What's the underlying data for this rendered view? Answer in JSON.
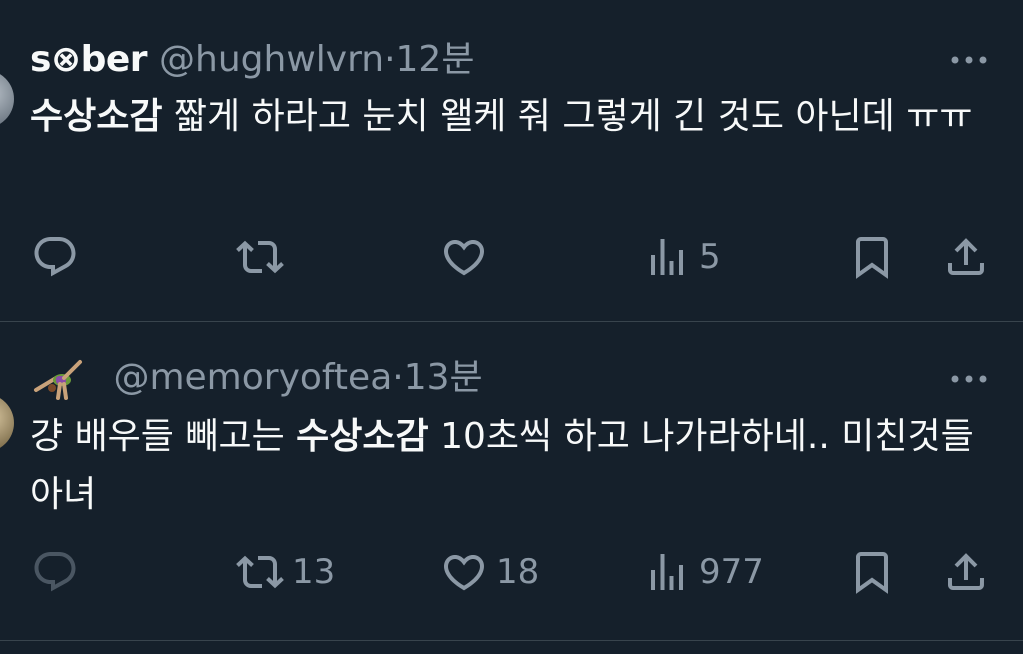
{
  "tweets": [
    {
      "name": "s⊗ber",
      "handle": "@hughwlvrn",
      "dot": "·",
      "time": "12분",
      "text_hl": "수상소감",
      "text_rest": " 짧게 하라고 눈치 왤케 줘 그렇게 긴 것도 아닌데 ㅠㅠ",
      "reply_count": "",
      "retweet_count": "",
      "like_count": "",
      "view_count": "5"
    },
    {
      "name": "",
      "handle": "@memoryoftea",
      "dot": "·",
      "time": "13분",
      "text_before": "걍 배우들 빼고는 ",
      "text_hl": "수상소감",
      "text_after": " 10초씩 하고 나가라하네.. 미친것들 아녀",
      "reply_count": "",
      "retweet_count": "13",
      "like_count": "18",
      "view_count": "977"
    }
  ],
  "icons": {
    "reply": "reply-icon",
    "retweet": "retweet-icon",
    "like": "heart-icon",
    "views": "bar-chart-icon",
    "bookmark": "bookmark-icon",
    "share": "share-icon",
    "more": "more-dots-icon"
  },
  "colors": {
    "background": "#15202b",
    "text": "#f7f9f9",
    "muted": "#8b98a5",
    "divider": "#38444d"
  }
}
